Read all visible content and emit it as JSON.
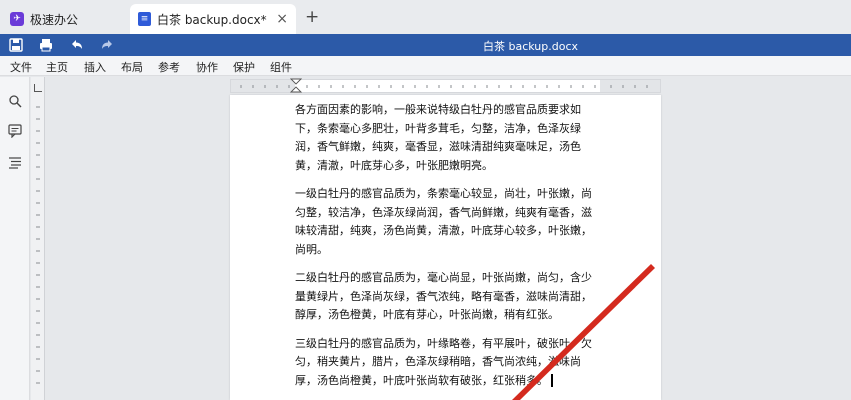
{
  "tabs": {
    "home": {
      "label": "极速办公",
      "icon": "app-logo-icon"
    },
    "document": {
      "label": "白茶 backup.docx*",
      "icon": "document-icon",
      "close": "×"
    },
    "add": "+"
  },
  "toolbar": {
    "title": "白茶 backup.docx",
    "icons": [
      "save-icon",
      "print-icon",
      "undo-icon",
      "redo-icon"
    ],
    "color": "#2c5aa8"
  },
  "menu": [
    "文件",
    "主页",
    "插入",
    "布局",
    "参考",
    "协作",
    "保护",
    "组件"
  ],
  "sidebar": {
    "icons": [
      "search-icon",
      "comment-icon",
      "outline-icon"
    ]
  },
  "document": {
    "paragraphs": [
      "各方面因素的影响，一般来说特级白牡丹的感官品质要求如下，条索毫心多肥壮，叶背多茸毛，匀整，洁净，色泽灰绿润，香气鲜嫩，纯爽，毫香显，滋味清甜纯爽毫味足，汤色黄，清澈，叶底芽心多，叶张肥嫩明亮。",
      "一级白牡丹的感官品质为，条索毫心较显，尚壮，叶张嫩，尚匀整，较洁净，色泽灰绿尚润，香气尚鲜嫩，纯爽有毫香，滋味较清甜，纯爽，汤色尚黄，清澈，叶底芽心较多，叶张嫩，尚明。",
      "二级白牡丹的感官品质为，毫心尚显，叶张尚嫩，尚匀，含少量黄绿片，色泽尚灰绿，香气浓纯，略有毫香，滋味尚清甜，醇厚，汤色橙黄，叶底有芽心，叶张尚嫩，稍有红张。",
      "三级白牡丹的感官品质为，叶缘略卷，有平展叶，破张叶，欠匀，稍夹黄片，腊片，色泽灰绿稍暗，香气尚浓纯，滋味尚厚，汤色尚橙黄，叶底叶张尚软有破张，红张稍多。"
    ]
  },
  "annotation": {
    "color": "#d42a1e"
  }
}
